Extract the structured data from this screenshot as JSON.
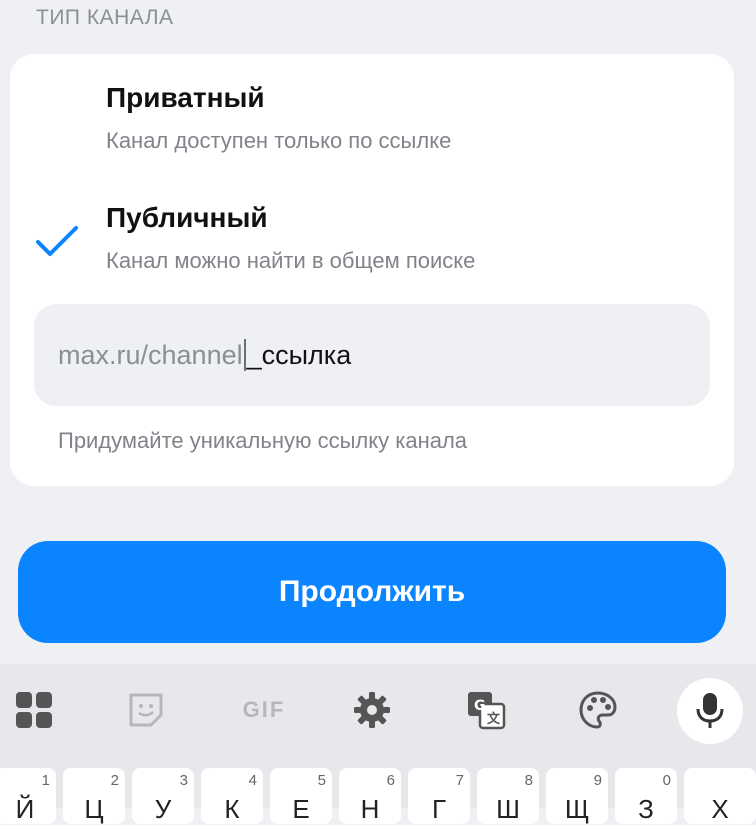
{
  "section_title": "ТИП КАНАЛА",
  "options": [
    {
      "title": "Приватный",
      "subtitle": "Канал доступен только по ссылке",
      "selected": false
    },
    {
      "title": "Публичный",
      "subtitle": "Канал можно найти в общем поиске",
      "selected": true
    }
  ],
  "link_field": {
    "prefix": "max.ru/channel",
    "value": "_ссылка"
  },
  "hint": "Придумайте уникальную ссылку канала",
  "continue_label": "Продолжить",
  "colors": {
    "accent": "#0a84ff",
    "background": "#eef0f3",
    "card": "#ffffff"
  },
  "keyboard": {
    "toolbar_icons": [
      "apps-grid-icon",
      "sticker-icon",
      "gif-icon",
      "settings-gear-icon",
      "translate-icon",
      "palette-icon",
      "mic-icon"
    ],
    "gif_label": "GIF",
    "keys": [
      {
        "num": "1",
        "ch": "Й"
      },
      {
        "num": "2",
        "ch": "Ц"
      },
      {
        "num": "3",
        "ch": "У"
      },
      {
        "num": "4",
        "ch": "К"
      },
      {
        "num": "5",
        "ch": "Е"
      },
      {
        "num": "6",
        "ch": "Н"
      },
      {
        "num": "7",
        "ch": "Г"
      },
      {
        "num": "8",
        "ch": "Ш"
      },
      {
        "num": "9",
        "ch": "Щ"
      },
      {
        "num": "0",
        "ch": "З"
      },
      {
        "num": "",
        "ch": "Х"
      }
    ]
  }
}
